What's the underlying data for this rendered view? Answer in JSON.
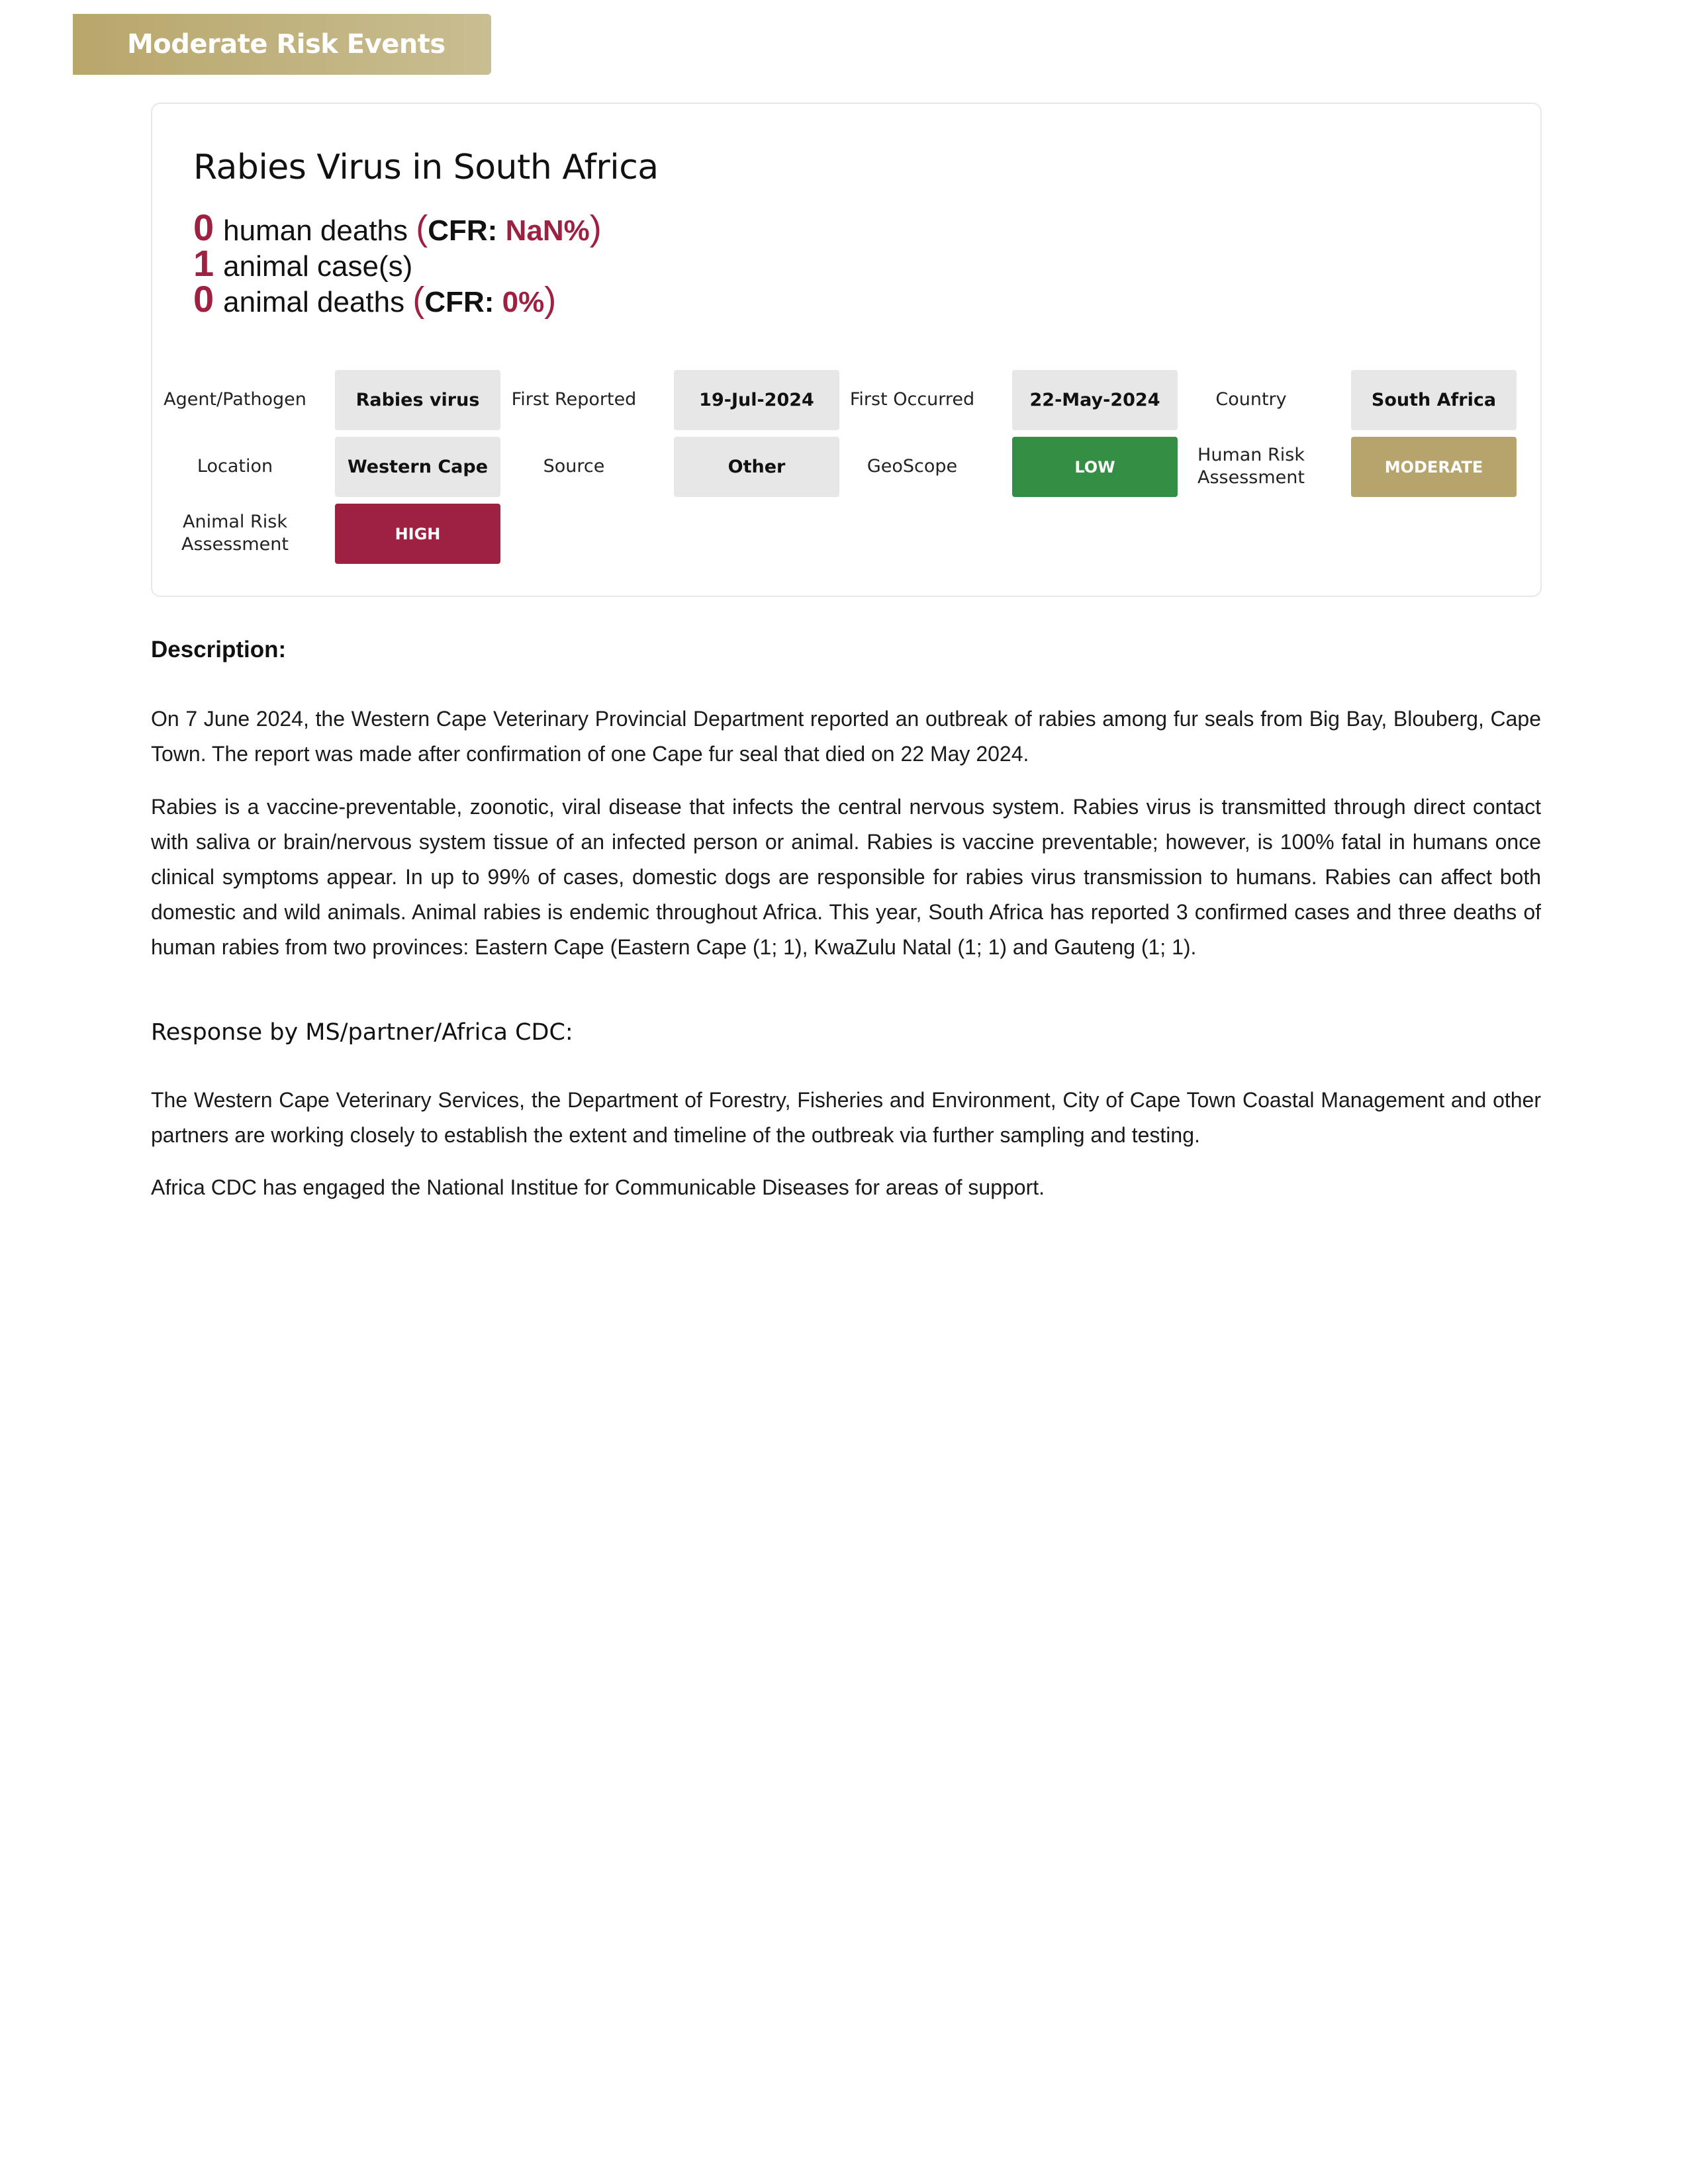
{
  "banner": {
    "label": "Moderate Risk Events"
  },
  "event": {
    "title": "Rabies Virus in South Africa",
    "stats": {
      "human_deaths": {
        "value": "0",
        "label": "human deaths",
        "cfr_label": "CFR:",
        "cfr_value": "NaN%"
      },
      "animal_cases": {
        "value": "1",
        "label": "animal case(s)"
      },
      "animal_deaths": {
        "value": "0",
        "label": "animal deaths",
        "cfr_label": "CFR:",
        "cfr_value": "0%"
      }
    },
    "fields": {
      "agent": {
        "label": "Agent/Pathogen",
        "value": "Rabies virus"
      },
      "first_reported": {
        "label": "First Reported",
        "value": "19-Jul-2024"
      },
      "first_occurred": {
        "label": "First Occurred",
        "value": "22-May-2024"
      },
      "country": {
        "label": "Country",
        "value": "South Africa"
      },
      "location": {
        "label": "Location",
        "value": "Western Cape"
      },
      "source": {
        "label": "Source",
        "value": "Other"
      },
      "geoscope": {
        "label": "GeoScope",
        "value": "LOW"
      },
      "human_risk": {
        "label_line1": "Human Risk",
        "label_line2": "Assessment",
        "value": "MODERATE"
      },
      "animal_risk": {
        "label_line1": "Animal Risk",
        "label_line2": "Assessment",
        "value": "HIGH"
      }
    }
  },
  "colors": {
    "accent_red": "#9e2141",
    "low_green": "#348e43",
    "moderate_gold": "#b6a46d",
    "banner_gold": "#b8a76b"
  },
  "description": {
    "heading": "Description:",
    "paragraphs": [
      "On 7 June 2024, the Western Cape Veterinary Provincial Department reported an outbreak of rabies among fur seals from Big Bay, Blouberg, Cape Town. The report was made after confirmation of one Cape fur seal that died on 22 May 2024.",
      "Rabies is a vaccine-preventable, zoonotic, viral disease that infects the central nervous system. Rabies virus is transmitted through direct contact with saliva or brain/nervous system tissue of an infected person or animal. Rabies is vaccine preventable; however, is 100% fatal in humans once clinical symptoms appear. In up to 99% of cases, domestic dogs are responsible for rabies virus transmission to humans. Rabies can affect both domestic and wild animals. Animal rabies is endemic throughout Africa. This year, South Africa has reported 3 confirmed cases and three deaths of human rabies from two provinces: Eastern Cape (Eastern Cape (1; 1), KwaZulu Natal (1; 1) and Gauteng (1; 1)."
    ]
  },
  "response": {
    "heading": "Response by MS/partner/Africa CDC:",
    "paragraphs": [
      "The Western Cape Veterinary Services, the Department of Forestry, Fisheries and Environment, City of Cape Town Coastal Management and other partners are working closely to establish the extent and timeline of the outbreak via further sampling and testing.",
      "Africa CDC has engaged the National Institue for Communicable Diseases for areas of support."
    ]
  }
}
